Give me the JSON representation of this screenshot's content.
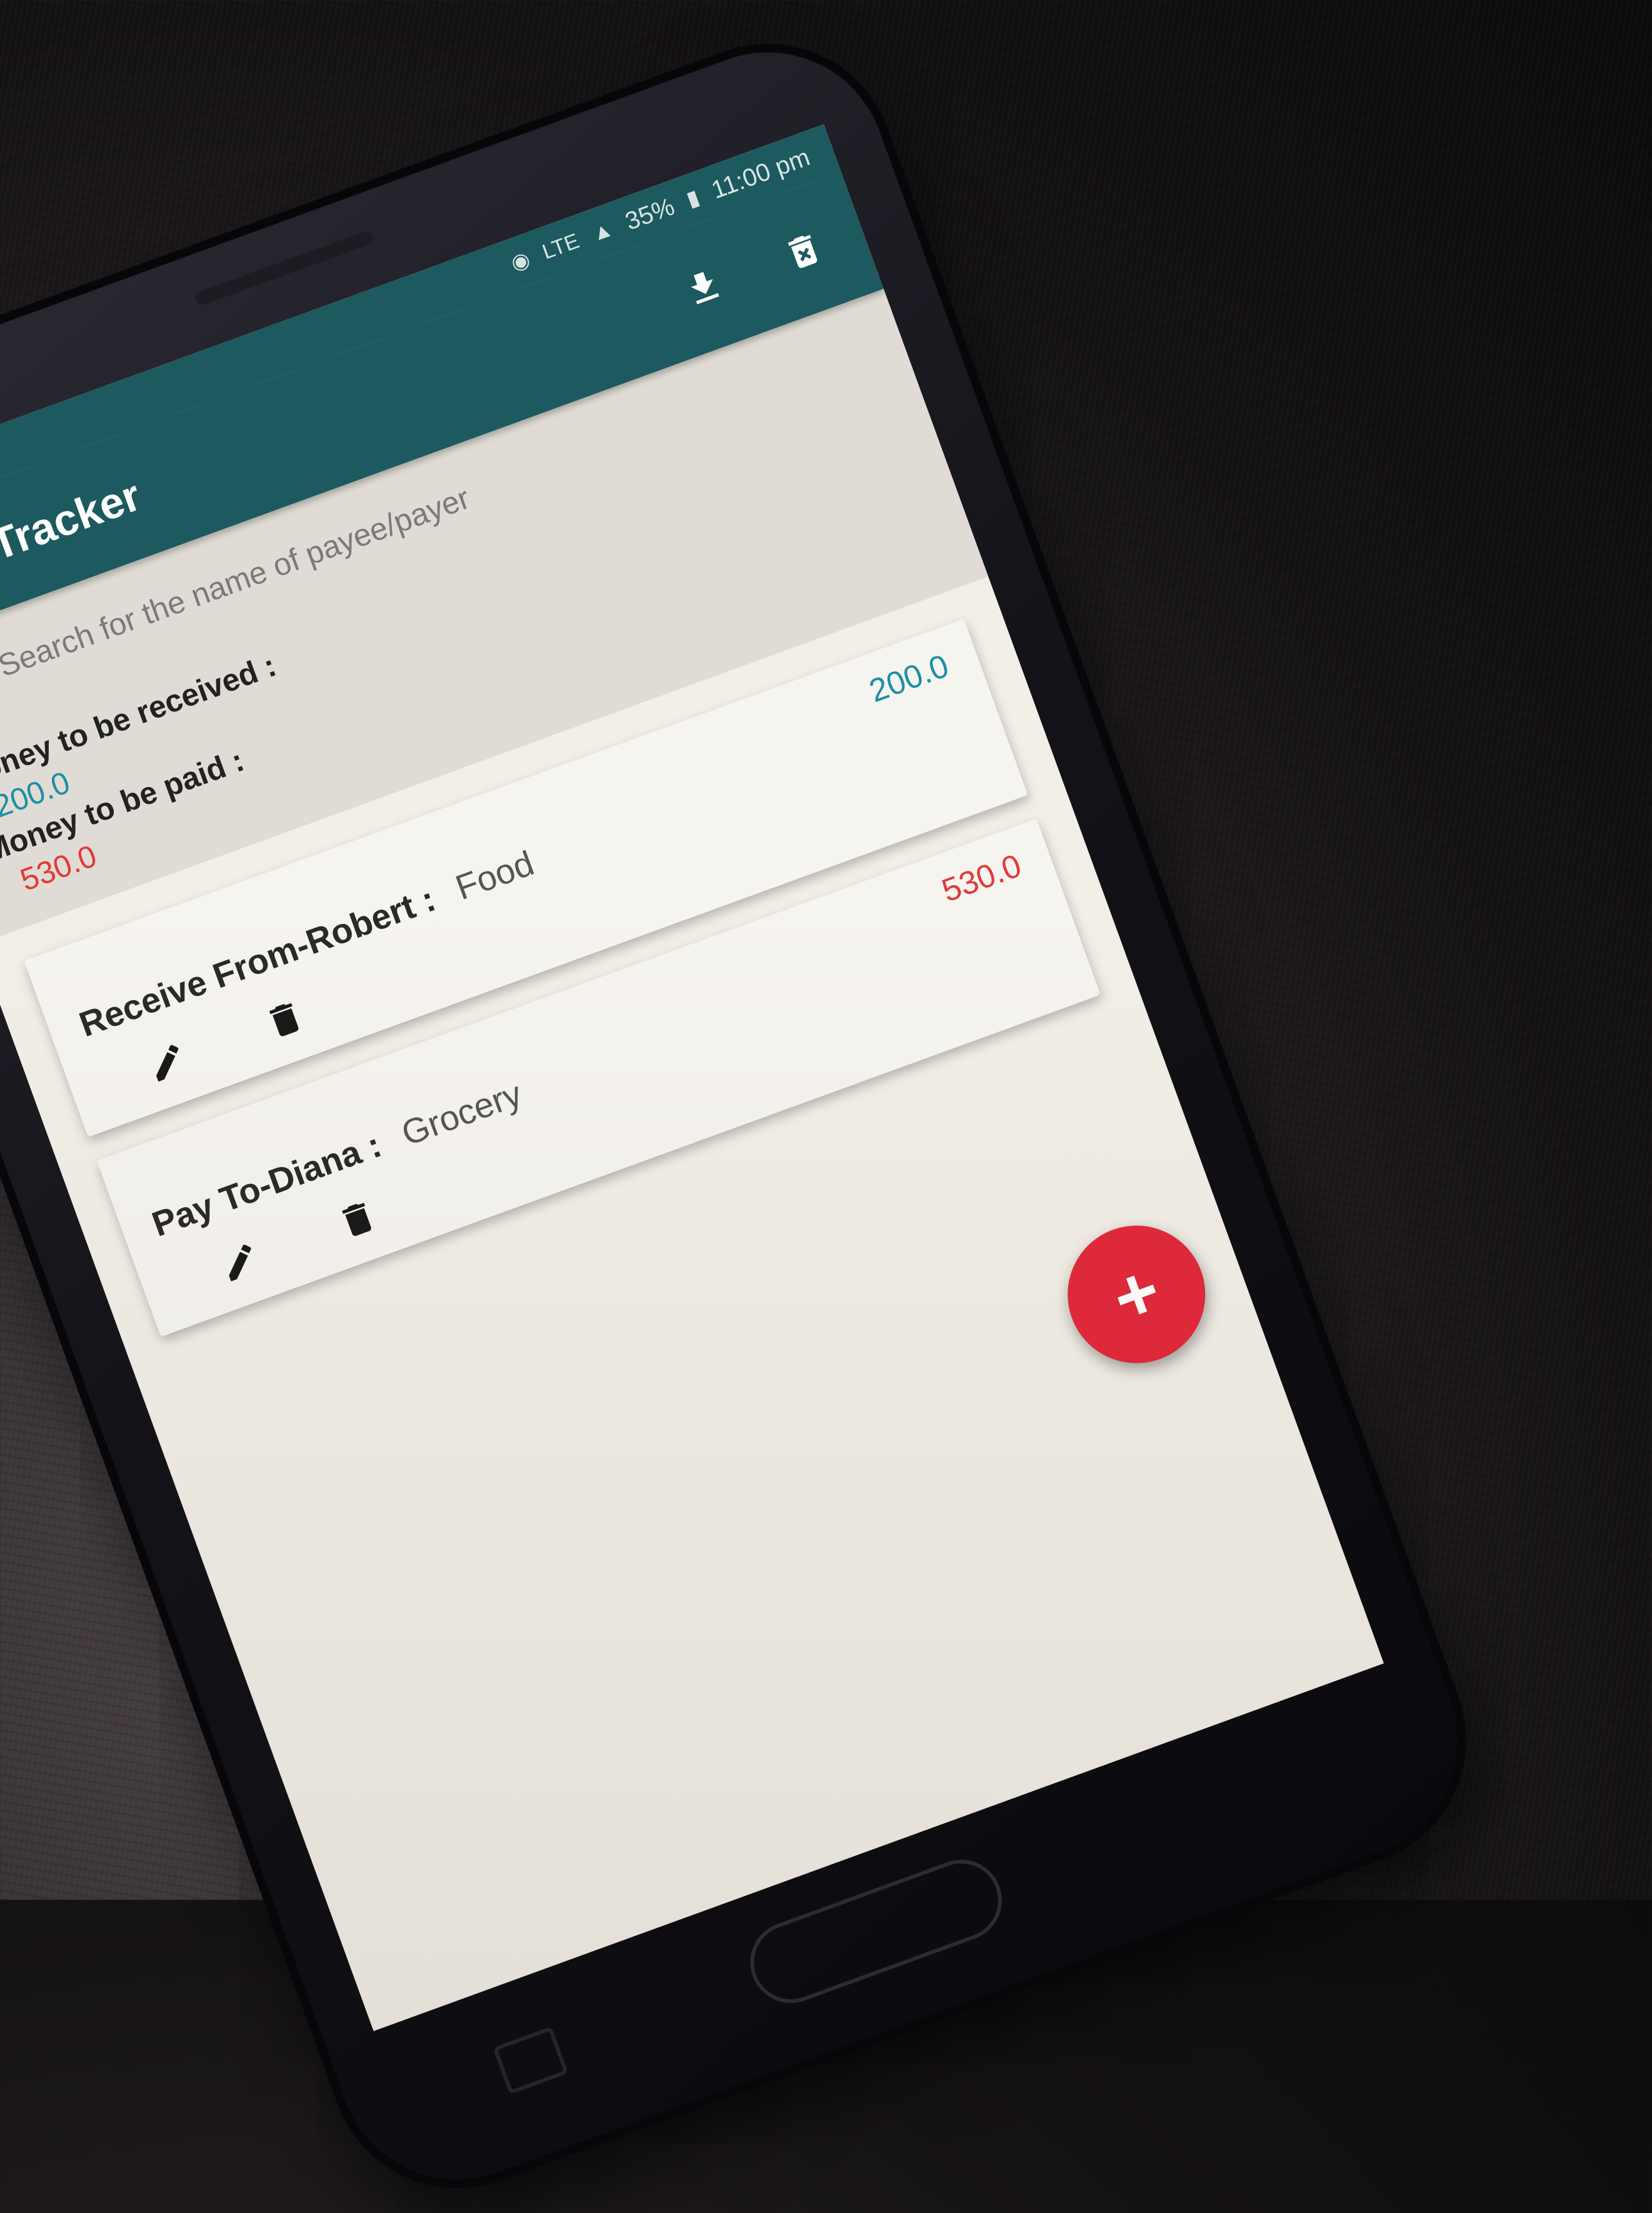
{
  "status_bar": {
    "battery": "35%",
    "time": "11:00 pm",
    "network": "LTE"
  },
  "app": {
    "title": "Debt Tracker"
  },
  "actions": {
    "export_icon": "download-icon",
    "delete_all_icon": "delete-all-icon"
  },
  "search": {
    "placeholder": "Search for the name of payee/payer",
    "icon": "search-icon"
  },
  "summary": {
    "received_label": "Money to be received :",
    "received_value": "200.0",
    "paid_label": "Money to be paid :",
    "paid_value": "530.0"
  },
  "entries": [
    {
      "amount": "200.0",
      "who": "Receive From-Robert :",
      "for": "Food",
      "amount_color": "#1b8fa6"
    },
    {
      "amount": "530.0",
      "who": "Pay To-Diana :",
      "for": "Grocery",
      "amount_color": "#e23a3a"
    }
  ],
  "fab": {
    "label": "+"
  },
  "colors": {
    "primary": "#1c5a5f",
    "accent": "#e2293b",
    "received": "#1b8fa6",
    "paid": "#e23a3a"
  }
}
